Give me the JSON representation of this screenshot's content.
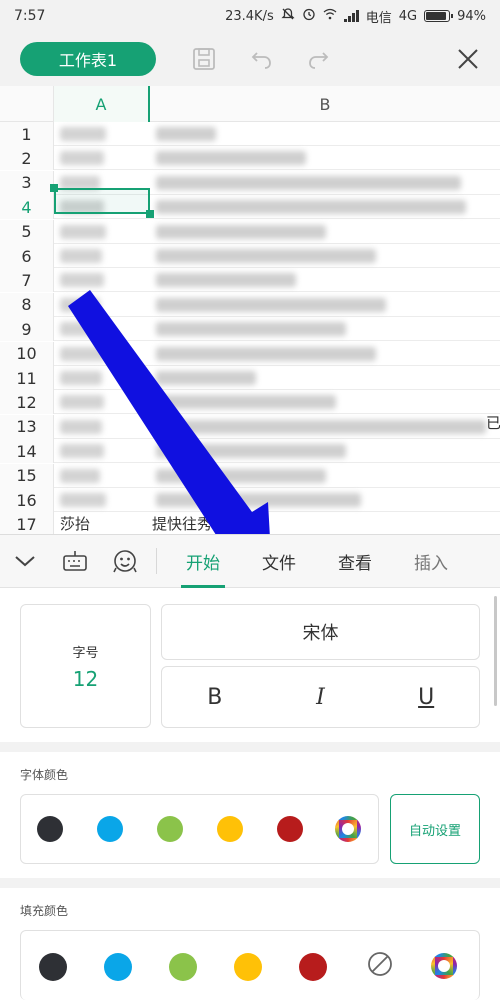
{
  "status_bar": {
    "time": "7:57",
    "speed": "23.4K/s",
    "carrier": "电信",
    "network": "4G",
    "battery": "94%",
    "battery_level": 0.94
  },
  "toolbar": {
    "sheet_name": "工作表1",
    "icons": [
      "save-icon",
      "undo-icon",
      "redo-icon",
      "close-icon"
    ]
  },
  "sheet": {
    "columns": [
      "A",
      "B"
    ],
    "rows": [
      "1",
      "2",
      "3",
      "4",
      "5",
      "6",
      "7",
      "8",
      "9",
      "10",
      "11",
      "12",
      "13",
      "14",
      "15",
      "16",
      "17"
    ],
    "active_row": "4",
    "row17": {
      "a": "莎抬",
      "b": "提快往秀乡 流程"
    },
    "cut_off_text": "已"
  },
  "tab_bar": {
    "icons": [
      "collapse-icon",
      "keyboard-icon",
      "face-icon"
    ],
    "tabs": [
      {
        "label": "开始",
        "active": true
      },
      {
        "label": "文件",
        "active": false
      },
      {
        "label": "查看",
        "active": false
      },
      {
        "label": "插入",
        "active": false
      }
    ]
  },
  "format_panel": {
    "font_size_label": "字号",
    "font_size_value": "12",
    "font_name": "宋体",
    "bold": "B",
    "italic": "I",
    "underline": "U",
    "font_color": {
      "label": "字体颜色",
      "swatches": [
        "#2e3035",
        "#0aa6e8",
        "#8bc34a",
        "#ffc107",
        "#b71c1c"
      ],
      "auto_label": "自动设置"
    },
    "fill_color": {
      "label": "填充颜色",
      "swatches": [
        "#2e3035",
        "#0aa6e8",
        "#8bc34a",
        "#ffc107",
        "#b71c1c"
      ]
    }
  },
  "colors": {
    "accent": "#16a174",
    "annotation_arrow": "#1010e0"
  }
}
